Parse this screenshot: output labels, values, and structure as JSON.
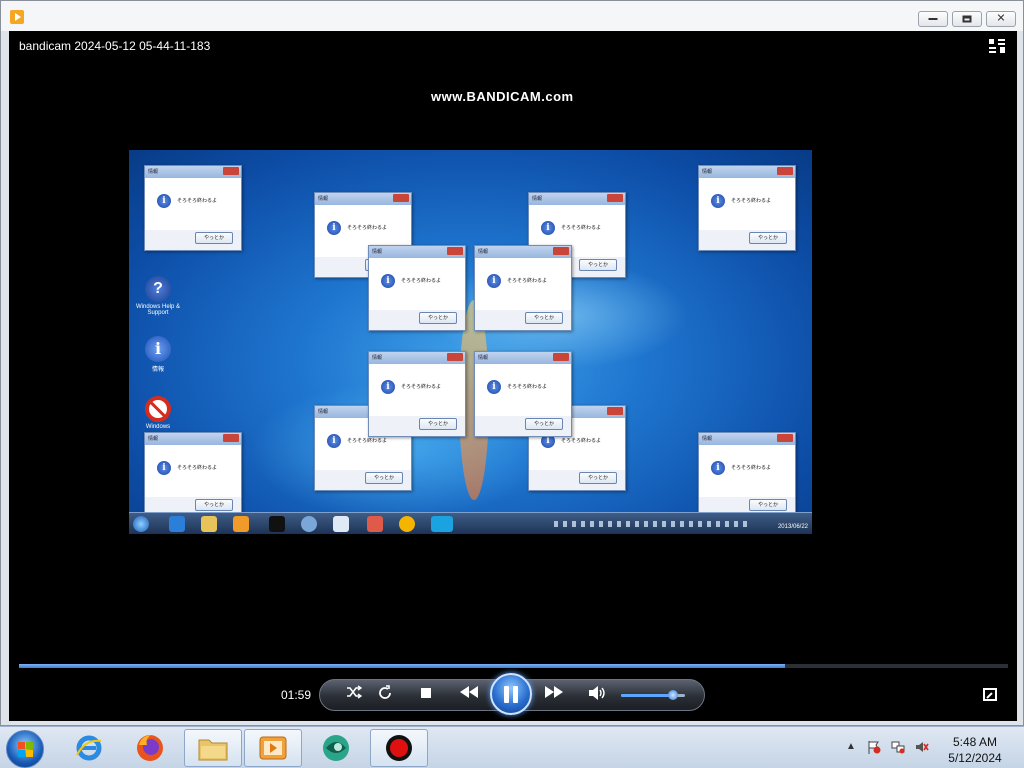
{
  "window": {
    "video_title": "bandicam 2024-05-12 05-44-11-183"
  },
  "video": {
    "watermark": "www.BANDICAM.com",
    "desktop_icons": [
      {
        "name": "help",
        "label": "Windows Help & Support"
      },
      {
        "name": "info",
        "label": "情報"
      },
      {
        "name": "stop",
        "label": "Windows"
      }
    ],
    "dialog": {
      "title": "情報",
      "message": "そろそろ終わるよ",
      "ok_label": "やっとか"
    },
    "clock_time": "",
    "clock_date": "2013/06/22"
  },
  "playback": {
    "elapsed": "01:59",
    "progress_fraction": 0.775,
    "volume_fraction": 0.82
  },
  "controls": {
    "shuffle_icon": "shuffle-icon",
    "repeat_icon": "repeat-icon",
    "stop_icon": "stop-icon",
    "prev_icon": "previous-icon",
    "pause_icon": "pause-icon",
    "next_icon": "next-icon",
    "volume_icon": "speaker-icon"
  },
  "taskbar": {
    "time": "5:48 AM",
    "date": "5/12/2024",
    "tray_arrow": "▲"
  },
  "colors": {
    "accent": "#3e7fd8",
    "close_red": "#c9453a"
  }
}
